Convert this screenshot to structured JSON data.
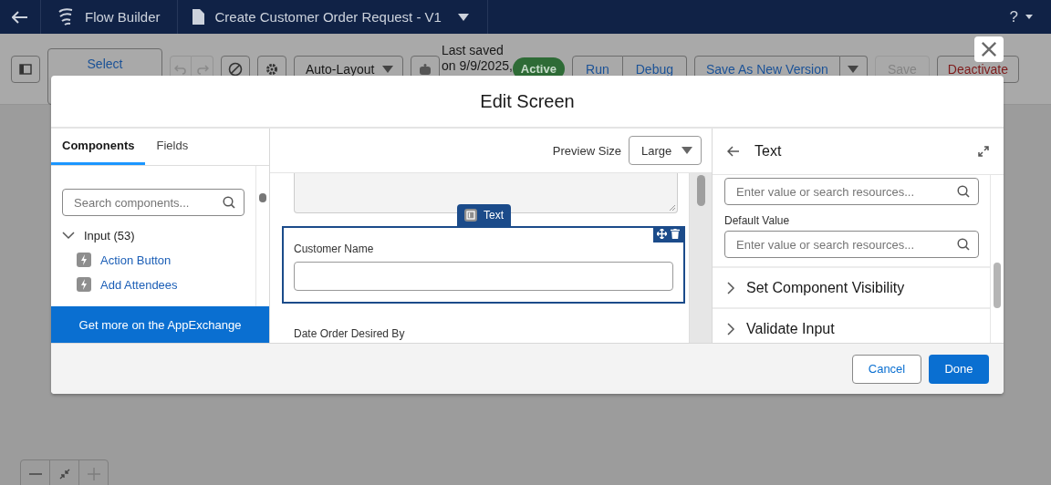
{
  "header": {
    "app": "Flow Builder",
    "flow_title": "Create Customer Order Request - V1",
    "help": "?"
  },
  "toolbar": {
    "select": "Select",
    "layout": "Auto-Layout",
    "last_saved": "Last saved",
    "saved_date": "on 9/9/2025,",
    "status": "Active",
    "run": "Run",
    "debug": "Debug",
    "save_as": "Save As New Version",
    "save": {
      "label": "Save",
      "disabled": true
    },
    "deactivate": "Deactivate"
  },
  "modal": {
    "title": "Edit Screen",
    "left": {
      "tabs": [
        {
          "label": "Components",
          "selected": true
        },
        {
          "label": "Fields",
          "selected": false
        }
      ],
      "search": {
        "placeholder": "Search components..."
      },
      "group": {
        "label": "Input (53)",
        "expanded": true,
        "items": [
          "Action Button",
          "Add Attendees"
        ]
      },
      "appexchange": "Get more on the AppExchange"
    },
    "center": {
      "preview_label": "Preview Size",
      "preview_value": "Large",
      "selected_badge": "Text",
      "fields": [
        {
          "label": "Customer Name",
          "selected": true
        },
        {
          "label": "Date Order Desired By",
          "selected": false
        }
      ]
    },
    "right": {
      "title": "Text",
      "fields": [
        {
          "placeholder": "Enter value or search resources..."
        },
        {
          "label": "Default Value",
          "placeholder": "Enter value or search resources..."
        }
      ],
      "sections": [
        {
          "label": "Set Component Visibility",
          "expanded": false
        },
        {
          "label": "Validate Input",
          "expanded": false
        }
      ]
    },
    "cancel": "Cancel",
    "done": "Done"
  }
}
